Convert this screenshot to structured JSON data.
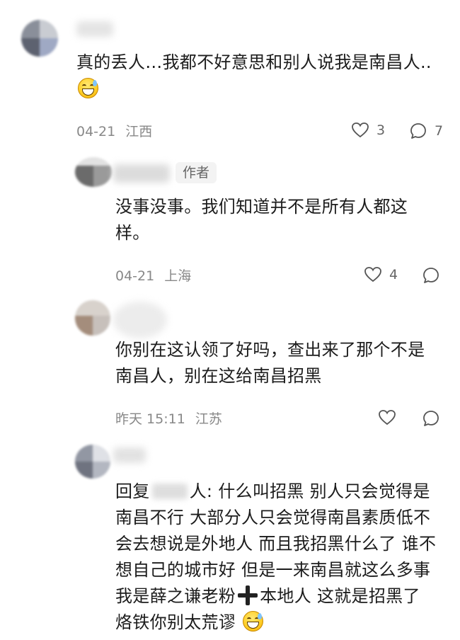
{
  "comments": [
    {
      "text_line1": "真的丢人…我都不好意思和别人说我是南昌人..",
      "date": "04-21",
      "location": "江西",
      "likes": "3",
      "replies": "7",
      "emoji": "grinning-sweat"
    },
    {
      "author_tag": "作者",
      "text_line1": "没事没事。我们知道并不是所有人都这",
      "text_line2": "样。",
      "date": "04-21",
      "location": "上海",
      "likes": "4"
    },
    {
      "text_line1": "你别在这认领了好吗，查出来了那个不是",
      "text_line2": "南昌人，别在这给南昌招黑",
      "date": "昨天 15:11",
      "location": "江苏"
    },
    {
      "reply_prefix": "回复",
      "reply_suffix": "人: 什么叫招黑 别人只会觉得是",
      "line2": "南昌不行 大部分人只会觉得南昌素质低不",
      "line3": "会去想说是外地人 而且我招黑什么了 谁不",
      "line4": "想自己的城市好 但是一来南昌就这么多事",
      "line5a": "我是薛之谦老粉",
      "line5b": "本地人 这就是招黑了",
      "line6": "烙铁你别太荒谬",
      "emoji": "grinning-sweat"
    }
  ]
}
